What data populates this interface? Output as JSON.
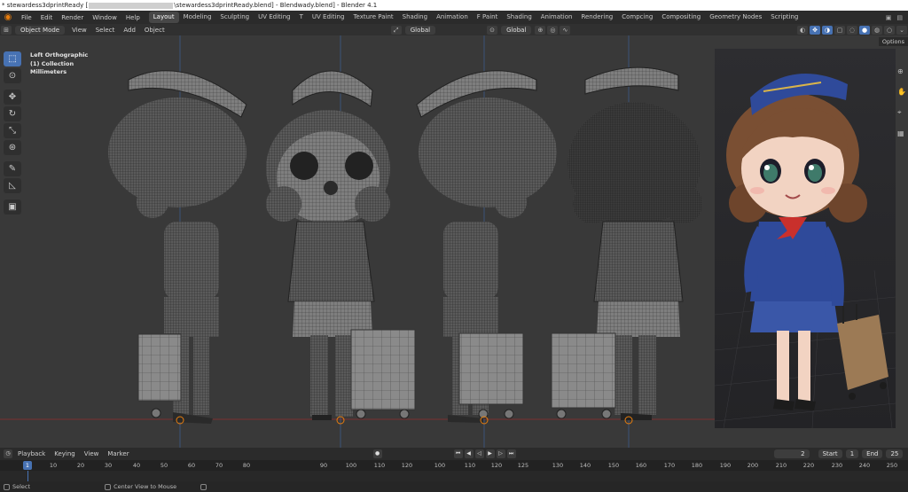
{
  "window": {
    "title_prefix": "* stewardess3dprintReady [",
    "title_middle": "\\stewardess3dprintReady.blend] - Blendwady.blend] - Blender 4.1"
  },
  "menu": {
    "items": [
      "File",
      "Edit",
      "Render",
      "Window",
      "Help"
    ],
    "workspace_tabs": [
      "Layout",
      "Modeling",
      "Sculpting",
      "UV Editing",
      "T",
      "UV Editing",
      "Texture Paint",
      "Shading",
      "Animation",
      "F Paint",
      "Shading",
      "Animation",
      "Rendering",
      "Compcing",
      "Compositing",
      "Geometry Nodes",
      "Scripting"
    ],
    "active_tab": "Layout"
  },
  "viewport_header": {
    "mode": "Object Mode",
    "menus": [
      "View",
      "Select",
      "Add",
      "Object"
    ],
    "transform_orientation": "Global",
    "pivot": "Global",
    "options_label": "Options"
  },
  "viewport": {
    "view_name": "Left Orthographic",
    "collection": "(1) Collection",
    "units": "Millimeters"
  },
  "colors": {
    "accent": "#4772b3",
    "blender_orange": "#e87d0d",
    "viewport_bg": "#393939",
    "render_bg": "#2d2d30",
    "uniform_blue": "#2f4a9a",
    "scarf_red": "#c9302c",
    "hair_brown": "#7a4f33",
    "suitcase_tan": "#9c7a55",
    "skin": "#f2d3c2"
  },
  "timeline_header": {
    "menus": [
      "Playback",
      "Keying",
      "View",
      "Marker"
    ],
    "current_frame": "2",
    "start_label": "Start",
    "start_value": "1",
    "end_label": "End",
    "end_value": "25"
  },
  "timeline_ruler": {
    "current": "1",
    "ticks": [
      "10",
      "20",
      "30",
      "40",
      "50",
      "60",
      "70",
      "80",
      "90",
      "100",
      "110",
      "120",
      "100",
      "110",
      "120",
      "125",
      "130",
      "140",
      "150",
      "160",
      "170",
      "180",
      "190",
      "200",
      "210",
      "220",
      "230",
      "240",
      "250"
    ]
  },
  "status": {
    "select": "Select",
    "center_view": "Center View to Mouse"
  }
}
